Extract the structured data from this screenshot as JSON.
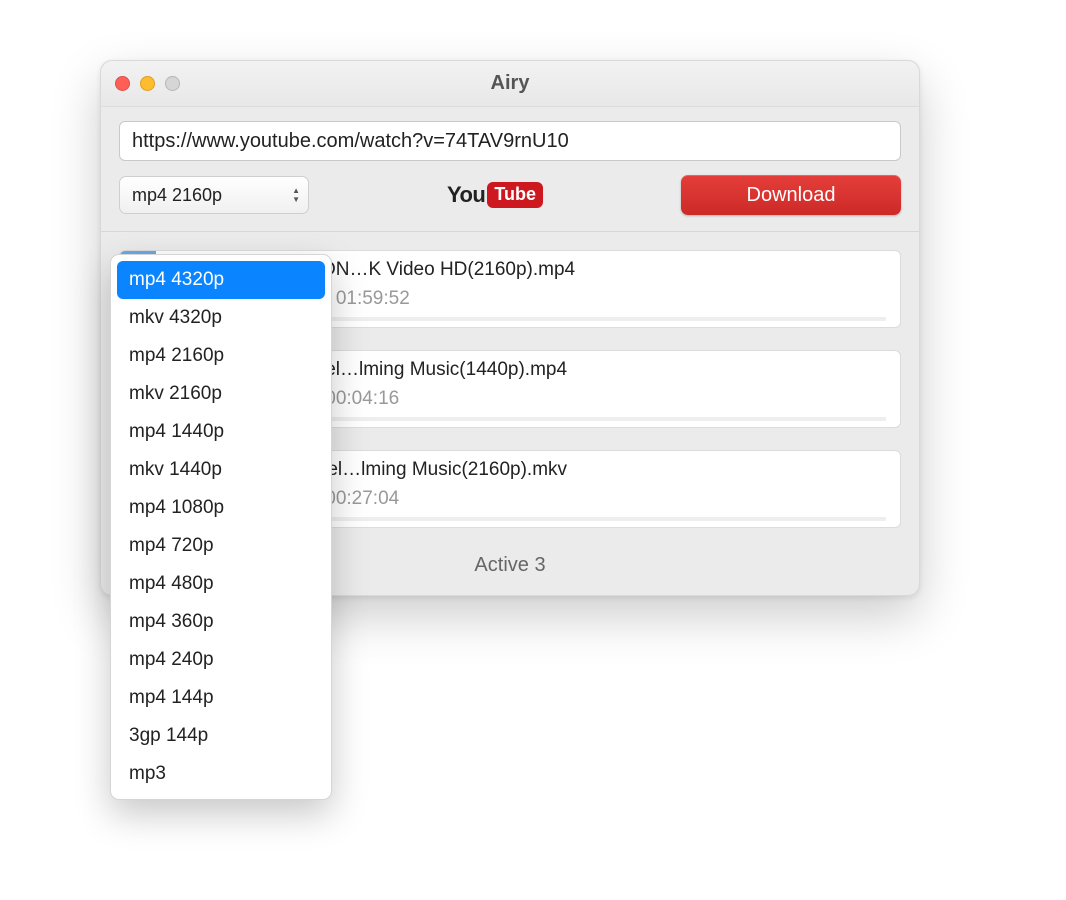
{
  "window": {
    "title": "Airy"
  },
  "url_input": {
    "value": "https://www.youtube.com/watch?v=74TAV9rnU10"
  },
  "format_select": {
    "selected": "mp4 2160p",
    "highlighted_index": 0,
    "options": [
      "mp4 4320p",
      "mkv 4320p",
      "mp4 2160p",
      "mkv 2160p",
      "mp4 1440p",
      "mkv 1440p",
      "mp4 1080p",
      "mp4 720p",
      "mp4 480p",
      "mp4 360p",
      "mp4 240p",
      "mp4 144p",
      "3gp 144p",
      "mp3"
    ]
  },
  "provider_logo": {
    "part1": "You",
    "part2": "Tube"
  },
  "download_button": {
    "label": "Download"
  },
  "downloads": [
    {
      "title": "ING OVER LONDON…K Video HD(2160p).mp4",
      "status": "0 GB of 18.54 GB / 01:59:52",
      "progress_percent": 0
    },
    {
      "title": "way 4K - Scenic Rel…lming Music(1440p).mp4",
      "status": "2 GB of 3.27 GB / 00:04:16",
      "progress_percent": 8
    },
    {
      "title": "aine 4K - Scenic Rel…lming Music(2160p).mkv",
      "status": "4 GB of 7.36 GB / 00:27:04",
      "progress_percent": 21
    }
  ],
  "footer": {
    "status": "Active 3"
  }
}
